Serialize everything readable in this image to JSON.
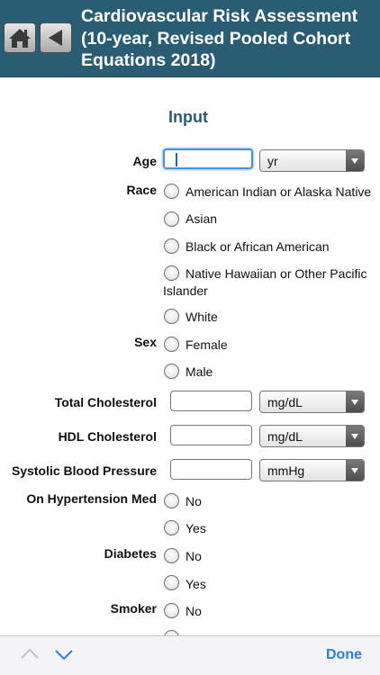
{
  "header": {
    "title": "Cardiovascular Risk Assessment (10-year, Revised Pooled Cohort Equations 2018)",
    "home_icon": "home-icon",
    "back_icon": "back-arrow-icon",
    "bg_color": "#2a5d73"
  },
  "section": {
    "title": "Input"
  },
  "age": {
    "label": "Age",
    "value": "",
    "unit": "yr"
  },
  "race": {
    "label": "Race",
    "options": [
      "American Indian or Alaska Native",
      "Asian",
      "Black or African American",
      "Native Hawaiian or Other Pacific",
      "Islander",
      "White"
    ]
  },
  "sex": {
    "label": "Sex",
    "options": [
      "Female",
      "Male"
    ]
  },
  "total_cholesterol": {
    "label": "Total Cholesterol",
    "value": "",
    "unit": "mg/dL"
  },
  "hdl_cholesterol": {
    "label": "HDL Cholesterol",
    "value": "",
    "unit": "mg/dL"
  },
  "systolic_bp": {
    "label": "Systolic Blood Pressure",
    "value": "",
    "unit": "mmHg"
  },
  "hypertension_med": {
    "label": "On Hypertension Med",
    "options": [
      "No",
      "Yes"
    ]
  },
  "diabetes": {
    "label": "Diabetes",
    "options": [
      "No",
      "Yes"
    ]
  },
  "smoker": {
    "label": "Smoker",
    "options": [
      "No"
    ]
  },
  "footer": {
    "prev_icon": "chevron-up-icon",
    "next_icon": "chevron-down-icon",
    "done_label": "Done",
    "accent": "#2a7fd8"
  }
}
